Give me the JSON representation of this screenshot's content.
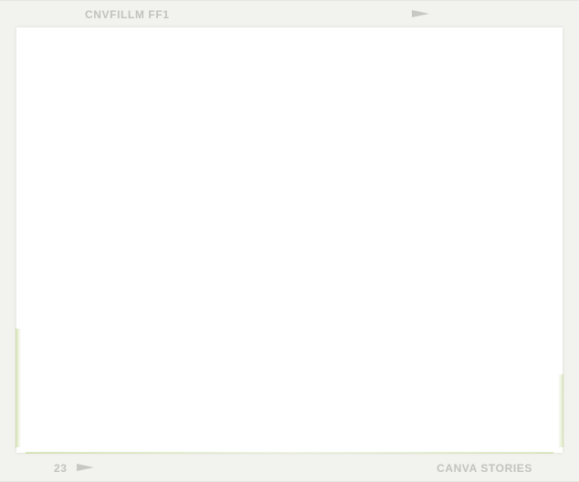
{
  "frame": {
    "top_label": "CNVFILLM FF1",
    "frame_number": "23",
    "bottom_label": "CANVA STORIES",
    "top_arrow_icon": "right-triangle-arrow-icon",
    "bottom_arrow_icon": "right-triangle-arrow-icon"
  },
  "colors": {
    "frame_background": "#f2f2ef",
    "window_background": "#ffffff",
    "label_color": "#c2c2bd",
    "edge_glow": "#c8dc98"
  }
}
